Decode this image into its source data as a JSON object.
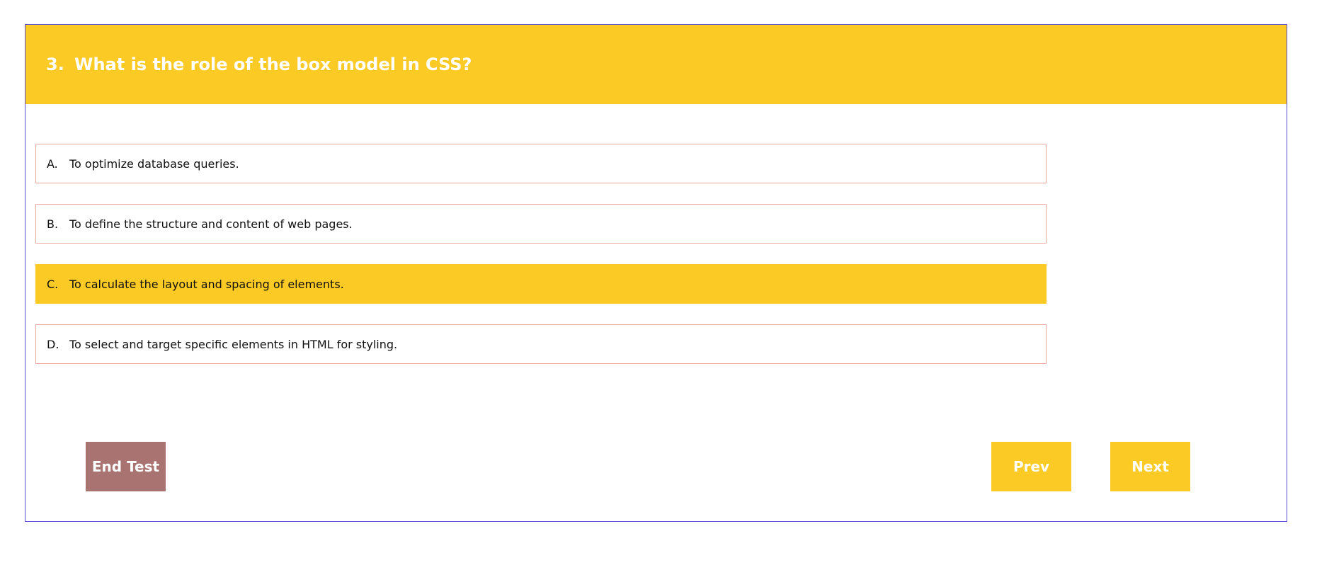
{
  "question": {
    "number": "3.",
    "text": "What is the role of the box model in CSS?"
  },
  "options": [
    {
      "letter": "A.",
      "text": "To optimize database queries.",
      "selected": false
    },
    {
      "letter": "B.",
      "text": "To define the structure and content of web pages.",
      "selected": false
    },
    {
      "letter": "C.",
      "text": "To calculate the layout and spacing of elements.",
      "selected": true
    },
    {
      "letter": "D.",
      "text": "To select and target specific elements in HTML for styling.",
      "selected": false
    }
  ],
  "buttons": {
    "end_test": "End Test",
    "prev": "Prev",
    "next": "Next"
  },
  "colors": {
    "accent": "#fcca25",
    "end_button": "#a87371",
    "card_border": "#5b4bd6",
    "option_border": "#f0a9a0"
  }
}
